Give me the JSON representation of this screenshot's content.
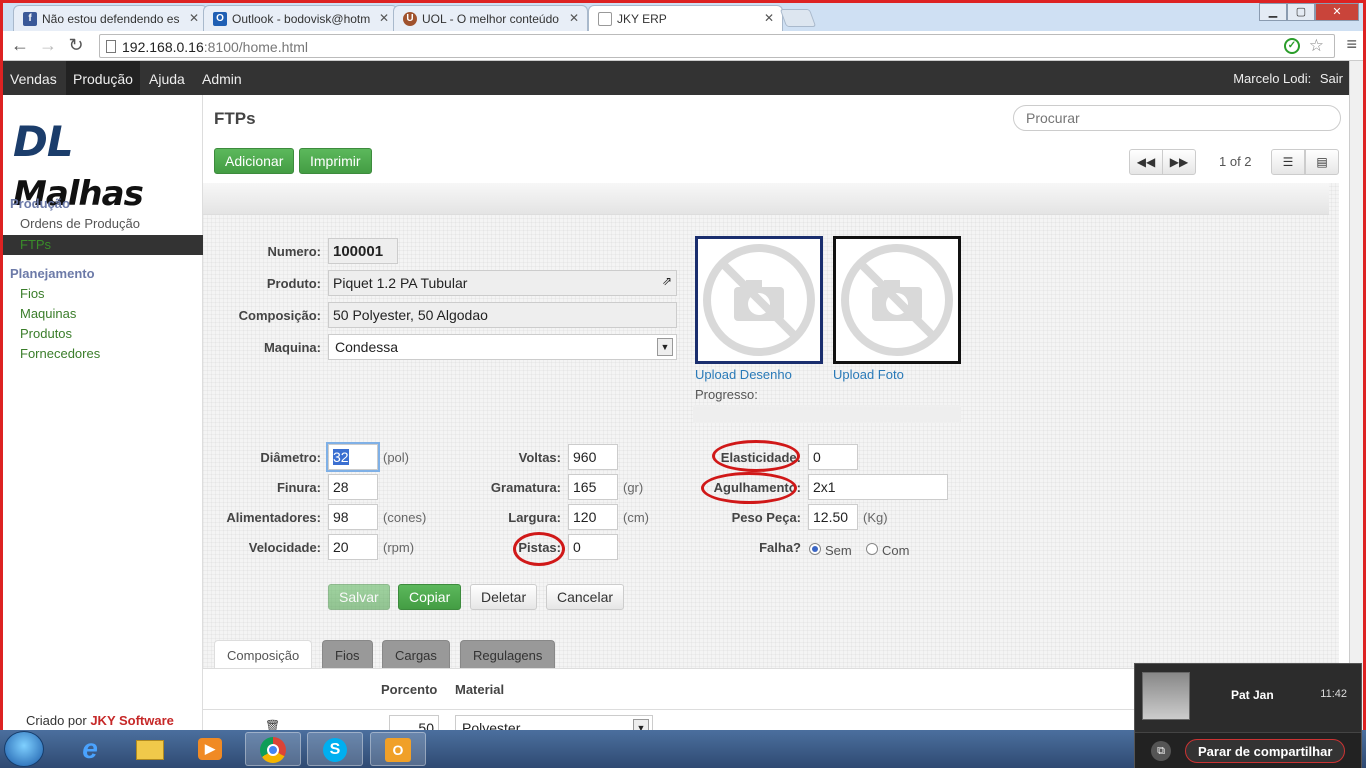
{
  "browser": {
    "tabs": [
      {
        "title": "Não estou defendendo es",
        "icon": "facebook-icon",
        "color": "#3b5998",
        "glyph": "f"
      },
      {
        "title": "Outlook - bodovisk@hotm",
        "icon": "outlook-icon",
        "color": "#1f5fb4",
        "glyph": "O"
      },
      {
        "title": "UOL - O melhor conteúdo",
        "icon": "uol-icon",
        "color": "#a0522d",
        "glyph": "U"
      },
      {
        "title": "JKY ERP",
        "icon": "page-icon",
        "color": "#999999",
        "glyph": ""
      }
    ],
    "window_buttons": {
      "minimize": "▁",
      "maximize": "▢",
      "close": "✕"
    },
    "url_host": "192.168.0.16",
    "url_rest": ":8100/home.html"
  },
  "navbar": {
    "items": [
      "Vendas",
      "Produção",
      "Ajuda",
      "Admin"
    ],
    "active": "Produção",
    "user": "Marcelo Lodi:",
    "logout": "Sair"
  },
  "sidebar": {
    "logo_dl": "DL",
    "logo_malhas": "Malhas",
    "section1": "Produção",
    "section1_items": [
      "Ordens de Produção",
      "FTPs"
    ],
    "section2": "Planejamento",
    "section2_items": [
      "Fios",
      "Maquinas",
      "Produtos",
      "Fornecedores"
    ],
    "credit_prefix": "Criado por",
    "credit_name": "JKY Software"
  },
  "page": {
    "title": "FTPs",
    "search_placeholder": "Procurar",
    "add": "Adicionar",
    "print": "Imprimir",
    "pager": "1 of 2"
  },
  "form": {
    "numero_label": "Numero:",
    "numero": "100001",
    "produto_label": "Produto:",
    "produto": "Piquet 1.2 PA Tubular",
    "composicao_label": "Composição:",
    "composicao": "50 Polyester, 50 Algodao",
    "maquina_label": "Maquina:",
    "maquina": "Condessa",
    "upload_desenho": "Upload Desenho",
    "upload_foto": "Upload Foto",
    "progresso_label": "Progresso:",
    "diametro_label": "Diâmetro:",
    "diametro": "32",
    "diametro_unit": "(pol)",
    "finura_label": "Finura:",
    "finura": "28",
    "alimentadores_label": "Alimentadores:",
    "alimentadores": "98",
    "alimentadores_unit": "(cones)",
    "velocidade_label": "Velocidade:",
    "velocidade": "20",
    "velocidade_unit": "(rpm)",
    "voltas_label": "Voltas:",
    "voltas": "960",
    "gramatura_label": "Gramatura:",
    "gramatura": "165",
    "gramatura_unit": "(gr)",
    "largura_label": "Largura:",
    "largura": "120",
    "largura_unit": "(cm)",
    "pistas_label": "Pistas:",
    "pistas": "0",
    "elasticidade_label": "Elasticidade:",
    "elasticidade": "0",
    "agulhamento_label": "Agulhamento:",
    "agulhamento": "2x1",
    "peso_label": "Peso Peça:",
    "peso": "12.50",
    "peso_unit": "(Kg)",
    "falha_label": "Falha?",
    "falha_sem": "Sem",
    "falha_com": "Com",
    "falha_selected": "Sem",
    "save": "Salvar",
    "copy": "Copiar",
    "delete": "Deletar",
    "cancel": "Cancelar"
  },
  "subtabs": {
    "items": [
      "Composição",
      "Fios",
      "Cargas",
      "Regulagens"
    ],
    "active": "Composição",
    "col_percent": "Porcento",
    "col_material": "Material",
    "row_percent": "50",
    "row_material": "Polyester"
  },
  "hangout": {
    "name": "Pat Jan",
    "time": "11:42",
    "stop_sharing": "Parar de compartilhar"
  },
  "taskbar": {
    "apps": [
      "windows-start-icon",
      "internet-explorer-icon",
      "file-explorer-icon",
      "media-player-icon",
      "chrome-icon",
      "skype-icon",
      "outlook-app-icon"
    ]
  }
}
